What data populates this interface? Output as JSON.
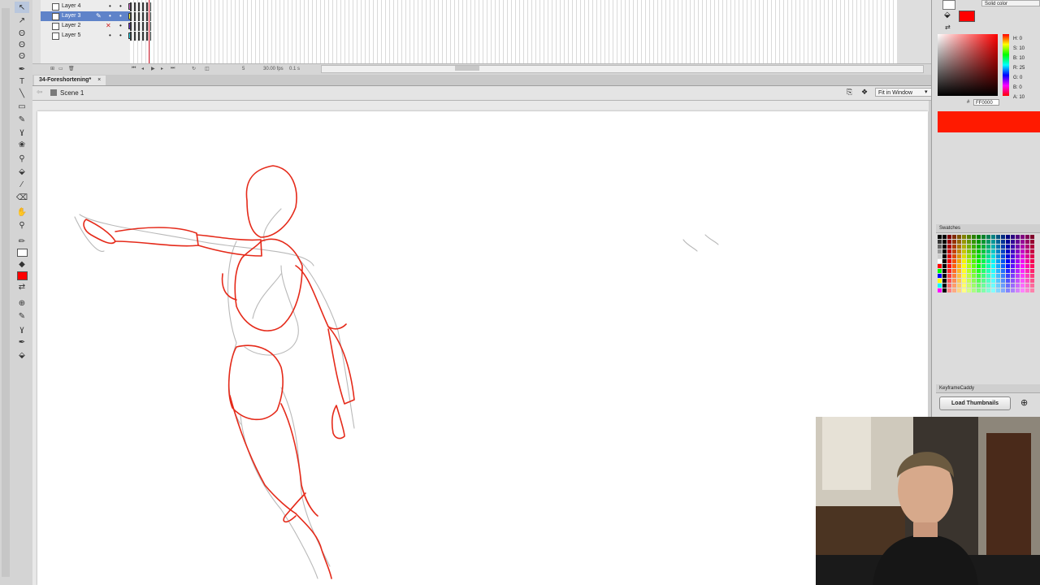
{
  "timeline": {
    "layers": [
      {
        "name": "Layer 4",
        "color": "#cc66cc"
      },
      {
        "name": "Layer 3",
        "color": "#ffff44",
        "selected": true
      },
      {
        "name": "Layer 2",
        "color": "#6a33cc"
      },
      {
        "name": "Layer 5",
        "color": "#22d6e8"
      }
    ],
    "fps": "30.00 fps",
    "time": "0.1 s",
    "frame": "5"
  },
  "document": {
    "tab_label": "34-Foreshortening*",
    "close_glyph": "×",
    "scene_label": "Scene 1",
    "zoom_label": "Fit in Window"
  },
  "color_panel": {
    "mode": "Solid color",
    "hsb": [
      "H: 0",
      "S: 10",
      "B: 10",
      "R: 25",
      "G: 0",
      "B: 0",
      "A: 10"
    ],
    "hex_prefix": "#",
    "hex": "FF0000",
    "fill_color": "#ff0000"
  },
  "swatches": {
    "title": "Swatches"
  },
  "keyframe_caddy": {
    "title": "KeyframeCaddy",
    "button_label": "Load Thumbnails"
  },
  "icons": {
    "arrow": "↖",
    "subselect": "↗",
    "lasso": "ʘ",
    "pen": "✒",
    "text": "T",
    "line": "╲",
    "rect": "▭",
    "pencil": "✎",
    "brush": "ɣ",
    "deco": "❀",
    "bone": "⚲",
    "bucket": "⬙",
    "dropper": "⁄",
    "eraser": "⌫",
    "hand": "✋",
    "zoom": "⚲",
    "stroke": "✏",
    "fill": "◆",
    "swap": "⇄",
    "eye": "•",
    "lock": "•",
    "x_mark": "✕",
    "pencil_small": "✎",
    "back": "⇦",
    "edit_scene": "⎘",
    "edit_symbol": "❖",
    "caret": "▾",
    "magnify": "⊕"
  }
}
